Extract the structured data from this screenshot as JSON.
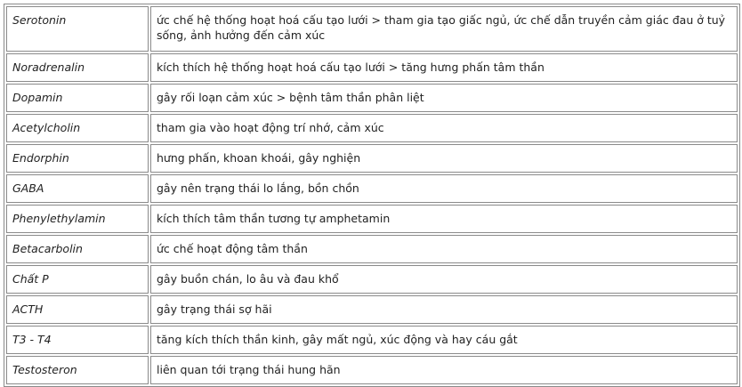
{
  "rows": [
    {
      "name": "Serotonin",
      "desc": "ức chế hệ thống hoạt hoá cấu tạo lưới > tham gia tạo giấc ngủ, ức chế dẫn truyền cảm giác đau ở tuỷ sống, ảnh hưởng đến cảm xúc"
    },
    {
      "name": "Noradrenalin",
      "desc": "kích thích hệ thống hoạt hoá cấu tạo lưới > tăng hưng phấn tâm thần"
    },
    {
      "name": "Dopamin",
      "desc": "gây rối loạn cảm xúc > bệnh tâm thần phân liệt"
    },
    {
      "name": "Acetylcholin",
      "desc": "tham gia vào hoạt động trí nhớ, cảm xúc"
    },
    {
      "name": "Endorphin",
      "desc": "hưng phấn, khoan khoái, gây nghiện"
    },
    {
      "name": "GABA",
      "desc": "gây nên trạng thái lo lắng, bồn chồn"
    },
    {
      "name": "Phenylethylamin",
      "desc": "kích thích tâm thần tương tự amphetamin"
    },
    {
      "name": "Betacarbolin",
      "desc": "ức chế hoạt động tâm thần"
    },
    {
      "name": "Chất P",
      "desc": "gây buồn chán, lo âu và đau khổ"
    },
    {
      "name": "ACTH",
      "desc": "gây trạng thái sợ hãi"
    },
    {
      "name": "T3 - T4",
      "desc": "tăng kích thích thần kinh, gây mất ngủ, xúc động và hay cáu gắt"
    },
    {
      "name": "Testosteron",
      "desc": "liên quan tới trạng thái hung hãn"
    }
  ]
}
